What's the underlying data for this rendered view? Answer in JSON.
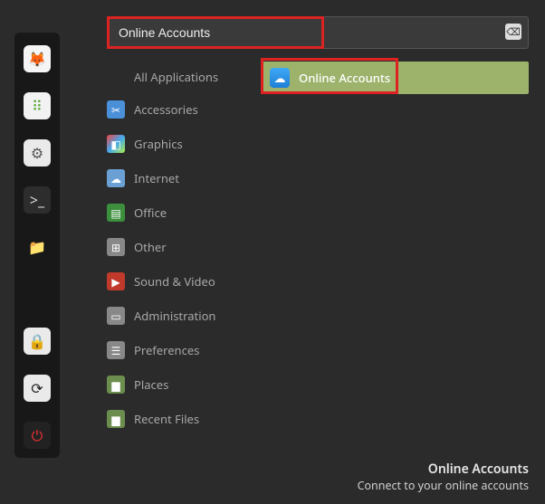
{
  "launcher": {
    "items": [
      {
        "name": "firefox",
        "bg": "#f5f5f5",
        "glyph": "🦊",
        "glyphColor": "#e66000"
      },
      {
        "name": "apps",
        "bg": "#f2f2f2",
        "glyph": "⠿",
        "glyphColor": "#5aaa3c"
      },
      {
        "name": "settings",
        "bg": "#eaeaea",
        "glyph": "⚙",
        "glyphColor": "#555"
      },
      {
        "name": "terminal",
        "bg": "#2d2d2d",
        "glyph": ">_",
        "glyphColor": "#ddd"
      },
      {
        "name": "files",
        "bg": "transparent",
        "glyph": "📁",
        "glyphColor": "#9fcd4d"
      },
      {
        "name": "lock",
        "bg": "#eaeaea",
        "glyph": "🔒",
        "glyphColor": "#222"
      },
      {
        "name": "refresh",
        "bg": "#eaeaea",
        "glyph": "⟳",
        "glyphColor": "#222"
      },
      {
        "name": "power",
        "bg": "#222",
        "glyph": "⏻",
        "glyphColor": "#e33"
      }
    ]
  },
  "search": {
    "value": "Online Accounts",
    "clear_glyph": "⌫"
  },
  "categories": [
    {
      "label": "All Applications",
      "icon": "",
      "bg": "transparent"
    },
    {
      "label": "Accessories",
      "icon": "✂",
      "bg": "#4a90d9"
    },
    {
      "label": "Graphics",
      "icon": "◧",
      "bg": "linear-gradient(135deg,#e44,#4ae,#ae4)"
    },
    {
      "label": "Internet",
      "icon": "☁",
      "bg": "#6aa0d4"
    },
    {
      "label": "Office",
      "icon": "▤",
      "bg": "#3c8f3c"
    },
    {
      "label": "Other",
      "icon": "⊞",
      "bg": "#888"
    },
    {
      "label": "Sound & Video",
      "icon": "▶",
      "bg": "#c0392b"
    },
    {
      "label": "Administration",
      "icon": "▭",
      "bg": "#888"
    },
    {
      "label": "Preferences",
      "icon": "☰",
      "bg": "#888"
    },
    {
      "label": "Places",
      "icon": "▆",
      "bg": "#6b8e4e"
    },
    {
      "label": "Recent Files",
      "icon": "▆",
      "bg": "#6b8e4e"
    }
  ],
  "results": [
    {
      "label": "Online Accounts",
      "icon": "☁"
    }
  ],
  "footer": {
    "title": "Online Accounts",
    "desc": "Connect to your online accounts"
  }
}
